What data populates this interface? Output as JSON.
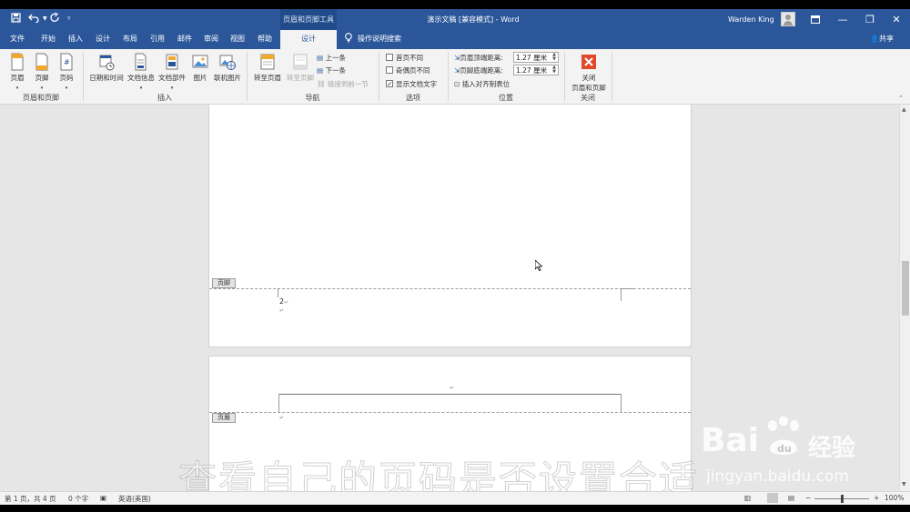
{
  "titlebar": {
    "contextual_tab": "页眉和页脚工具",
    "document_title": "演示文稿 [兼容模式] - Word",
    "user_name": "Warden King",
    "quick_access": [
      "save-icon",
      "undo-icon",
      "redo-icon",
      "customize-icon"
    ]
  },
  "tabs": [
    "文件",
    "开始",
    "插入",
    "设计",
    "布局",
    "引用",
    "邮件",
    "审阅",
    "视图",
    "帮助",
    "设计"
  ],
  "active_tab_index": 10,
  "tell_me": "操作说明搜索",
  "share": "共享",
  "ribbon": {
    "group_header_footer": {
      "label": "页眉和页脚",
      "buttons": [
        "页眉",
        "页脚",
        "页码"
      ]
    },
    "group_insert": {
      "label": "插入",
      "buttons": [
        "日期和时间",
        "文档信息",
        "文档部件",
        "图片",
        "联机图片"
      ]
    },
    "group_navigation": {
      "label": "导航",
      "goto_header": "转至页眉",
      "goto_footer": "转至页脚",
      "previous": "上一条",
      "next": "下一条",
      "link_previous": "链接到前一节"
    },
    "group_options": {
      "label": "选项",
      "different_first": "首页不同",
      "different_odd_even": "奇偶页不同",
      "show_doc_text": "显示文档文字",
      "show_doc_text_checked": true
    },
    "group_position": {
      "label": "位置",
      "header_from_top_label": "页眉顶端距离:",
      "header_from_top_value": "1.27 厘米",
      "footer_from_bottom_label": "页脚底端距离:",
      "footer_from_bottom_value": "1.27 厘米",
      "insert_alignment_tab": "插入对齐制表位"
    },
    "group_close": {
      "label": "关闭",
      "button_line1": "关闭",
      "button_line2": "页眉和页脚"
    }
  },
  "document": {
    "footer_tag": "页脚",
    "header_tag": "页眉",
    "page_number": "2",
    "para_mark": "↵"
  },
  "watermark": {
    "caption": "查看自己的页码是否设置合适",
    "brand": "Bai",
    "brand_cn": "经验",
    "url": "jingyan.baidu.com"
  },
  "statusbar": {
    "page_info": "第 1 页，共 4 页",
    "word_count": "0 个字",
    "language": "英语(美国)",
    "zoom": "100%"
  }
}
